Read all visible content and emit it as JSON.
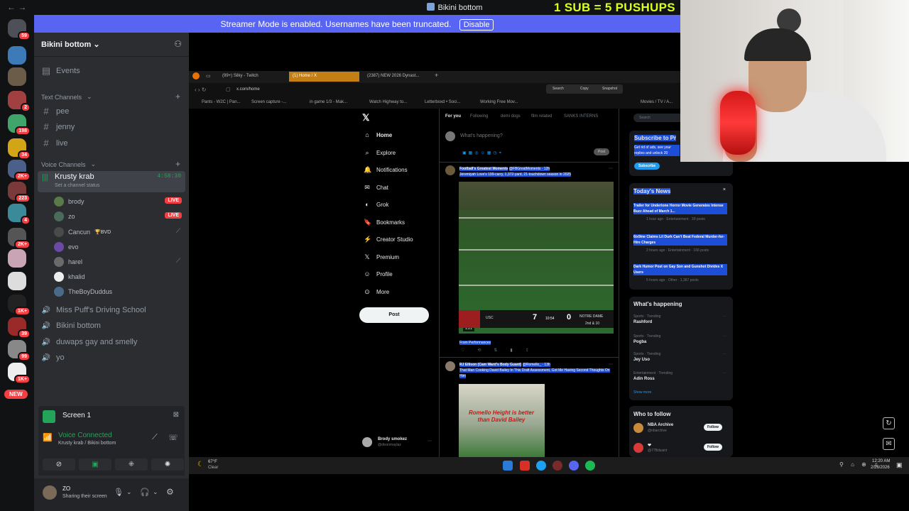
{
  "window": {
    "title": "Bikini bottom",
    "nav": "←   →",
    "overlay_text": "1 SUB = 5 PUSHUPS"
  },
  "banner": {
    "text": "Streamer Mode is enabled. Usernames have been truncated.",
    "disable_label": "Disable"
  },
  "rail": {
    "servers": [
      {
        "badge": "59",
        "color": "#4e5058"
      },
      {
        "badge": "",
        "color": "#3d7ab8"
      },
      {
        "badge": "",
        "color": "#6b5c4a"
      },
      {
        "badge": "2",
        "color": "#a04040"
      },
      {
        "badge": "198",
        "color": "#3fa56b"
      },
      {
        "badge": "34",
        "color": "#d1a516"
      },
      {
        "badge": "2K+",
        "color": "#4a5f8a"
      },
      {
        "badge": "223",
        "color": "#7a3a3a"
      },
      {
        "badge": "4",
        "color": "#3a8a9a"
      },
      {
        "badge": "2K+",
        "color": "#555"
      },
      {
        "badge": "",
        "color": "#c9a4b5"
      },
      {
        "badge": "",
        "color": "#ddd"
      },
      {
        "badge": "1K+",
        "color": "#222"
      },
      {
        "badge": "39",
        "color": "#9a2a2a"
      },
      {
        "badge": "99",
        "color": "#888"
      },
      {
        "badge": "1K+",
        "color": "#eee"
      }
    ],
    "new_label": "NEW"
  },
  "sidebar": {
    "guild_name": "Bikini bottom",
    "events_label": "Events",
    "text_category": "Text Channels",
    "text_channels": [
      "pee",
      "jenny",
      "live"
    ],
    "voice_category": "Voice Channels",
    "active_voice": {
      "name": "Krusty krab",
      "time": "4:58:30",
      "status": "Set a channel status"
    },
    "members": [
      {
        "name": "brody",
        "live": "LIVE",
        "color": "#5a7a4a"
      },
      {
        "name": "zo",
        "live": "LIVE",
        "color": "#4a6a5a"
      },
      {
        "name": "Cancun",
        "tag": "🏆BVD",
        "muted": true,
        "color": "#4a4a4a"
      },
      {
        "name": "evo",
        "color": "#6a4aa5"
      },
      {
        "name": "harel",
        "muted": true,
        "color": "#6a6a6a"
      },
      {
        "name": "khalid",
        "color": "#eeeeee"
      },
      {
        "name": "TheBoyDuddus",
        "color": "#4a6a8a"
      }
    ],
    "other_voice": [
      "Miss Puff's Driving School",
      "Bikini bottom",
      "duwaps gay and smelly",
      "yo"
    ]
  },
  "screen_panel": {
    "label": "Screen 1"
  },
  "voice_panel": {
    "status": "Voice Connected",
    "location": "Krusty krab / Bikini bottom"
  },
  "user_panel": {
    "name": "ZO",
    "status": "Sharing their screen"
  },
  "browser": {
    "tabs": [
      "(99+) Silky - Twitch",
      "(1) Home / X",
      "(2387) NEW 2026 Dynast..."
    ],
    "url": "x.com/home",
    "toolbar": [
      "Search",
      "Copy",
      "Snapshot"
    ],
    "bookmarks": [
      "Pants - W2C | Pan...",
      "Screen capture -...",
      "in game 1/3 - Mak...",
      "Watch Highway to...",
      "Letterboxd • Soci...",
      "Working Free Mov...",
      "Movies / TV / A..."
    ]
  },
  "x_nav": [
    "Home",
    "Explore",
    "Notifications",
    "Chat",
    "Grok",
    "Bookmarks",
    "Creator Studio",
    "Premium",
    "Profile",
    "More"
  ],
  "x_post_label": "Post",
  "x_account": {
    "name": "Brody smokez",
    "handle": "@dixonmaylaz"
  },
  "feed": {
    "tabs": [
      "For you",
      "Following",
      "demi dogs",
      "film related",
      "SANKS INTERNS"
    ],
    "compose_placeholder": "What's happening?",
    "post_btn": "Post",
    "tweet1": {
      "author": "Football's Greatest Moments",
      "handle": "@FBGreatMoments · 12h",
      "text": "Jeremiyah Love's 199-carry, 1,372-yard, 21-touchdown season in 2025",
      "duration": "1:21",
      "score": {
        "home": "USC",
        "home_score": "7",
        "away": "NOTRE DAME",
        "away_score": "0",
        "clock": "10:54",
        "down": "2nd & 10"
      },
      "from": "From Performances"
    },
    "tweet2": {
      "author": "RJ Ellison (Cam Ward's Body Guard)",
      "handle": "@Romello_ · 13h",
      "text": "That Man Cooking David Bailey In This Draft Assessment, Got Me Having Second Thoughts On Him",
      "caption": "Romello Height is better than David Bailey"
    }
  },
  "right": {
    "search_placeholder": "Search",
    "subscribe_title": "Subscribe to Pr",
    "subscribe_text": "Get rid of ads, see your replies and unlock 20",
    "subscribe_btn": "Subscribe",
    "news_title": "Today's News",
    "news": [
      {
        "headline": "Trailer for Undertone Horror Movie Generates Intense Buzz Ahead of March 1...",
        "meta": "1 hour ago · Entertainment · 39 posts"
      },
      {
        "headline": "6ix9ine Claims Lil Durk Can't Beat Federal Murder-for-Hire Charges",
        "meta": "2 hours ago · Entertainment · 166 posts"
      },
      {
        "headline": "Dark Humor Post on Gay Son and Gunshot Divides X Users",
        "meta": "5 hours ago · Other · 1,367 posts"
      }
    ],
    "happening_title": "What's happening",
    "trends": [
      {
        "cat": "Sports · Trending",
        "name": "Rashford"
      },
      {
        "cat": "Sports · Trending",
        "name": "Pogba"
      },
      {
        "cat": "Sports · Trending",
        "name": "Jey Uso"
      },
      {
        "cat": "Entertainment · Trending",
        "name": "Adin Ross"
      }
    ],
    "show_more": "Show more",
    "follow_title": "Who to follow",
    "follows": [
      {
        "name": "NBA Archive",
        "handle": "@nbarchive",
        "btn": "Follow"
      },
      {
        "name": "❤",
        "handle": "@77Bdsaint",
        "btn": "Follow"
      }
    ]
  },
  "taskbar": {
    "weather_temp": "67°F",
    "weather_desc": "Clear",
    "time": "12:20 AM",
    "date": "2/26/2026"
  }
}
